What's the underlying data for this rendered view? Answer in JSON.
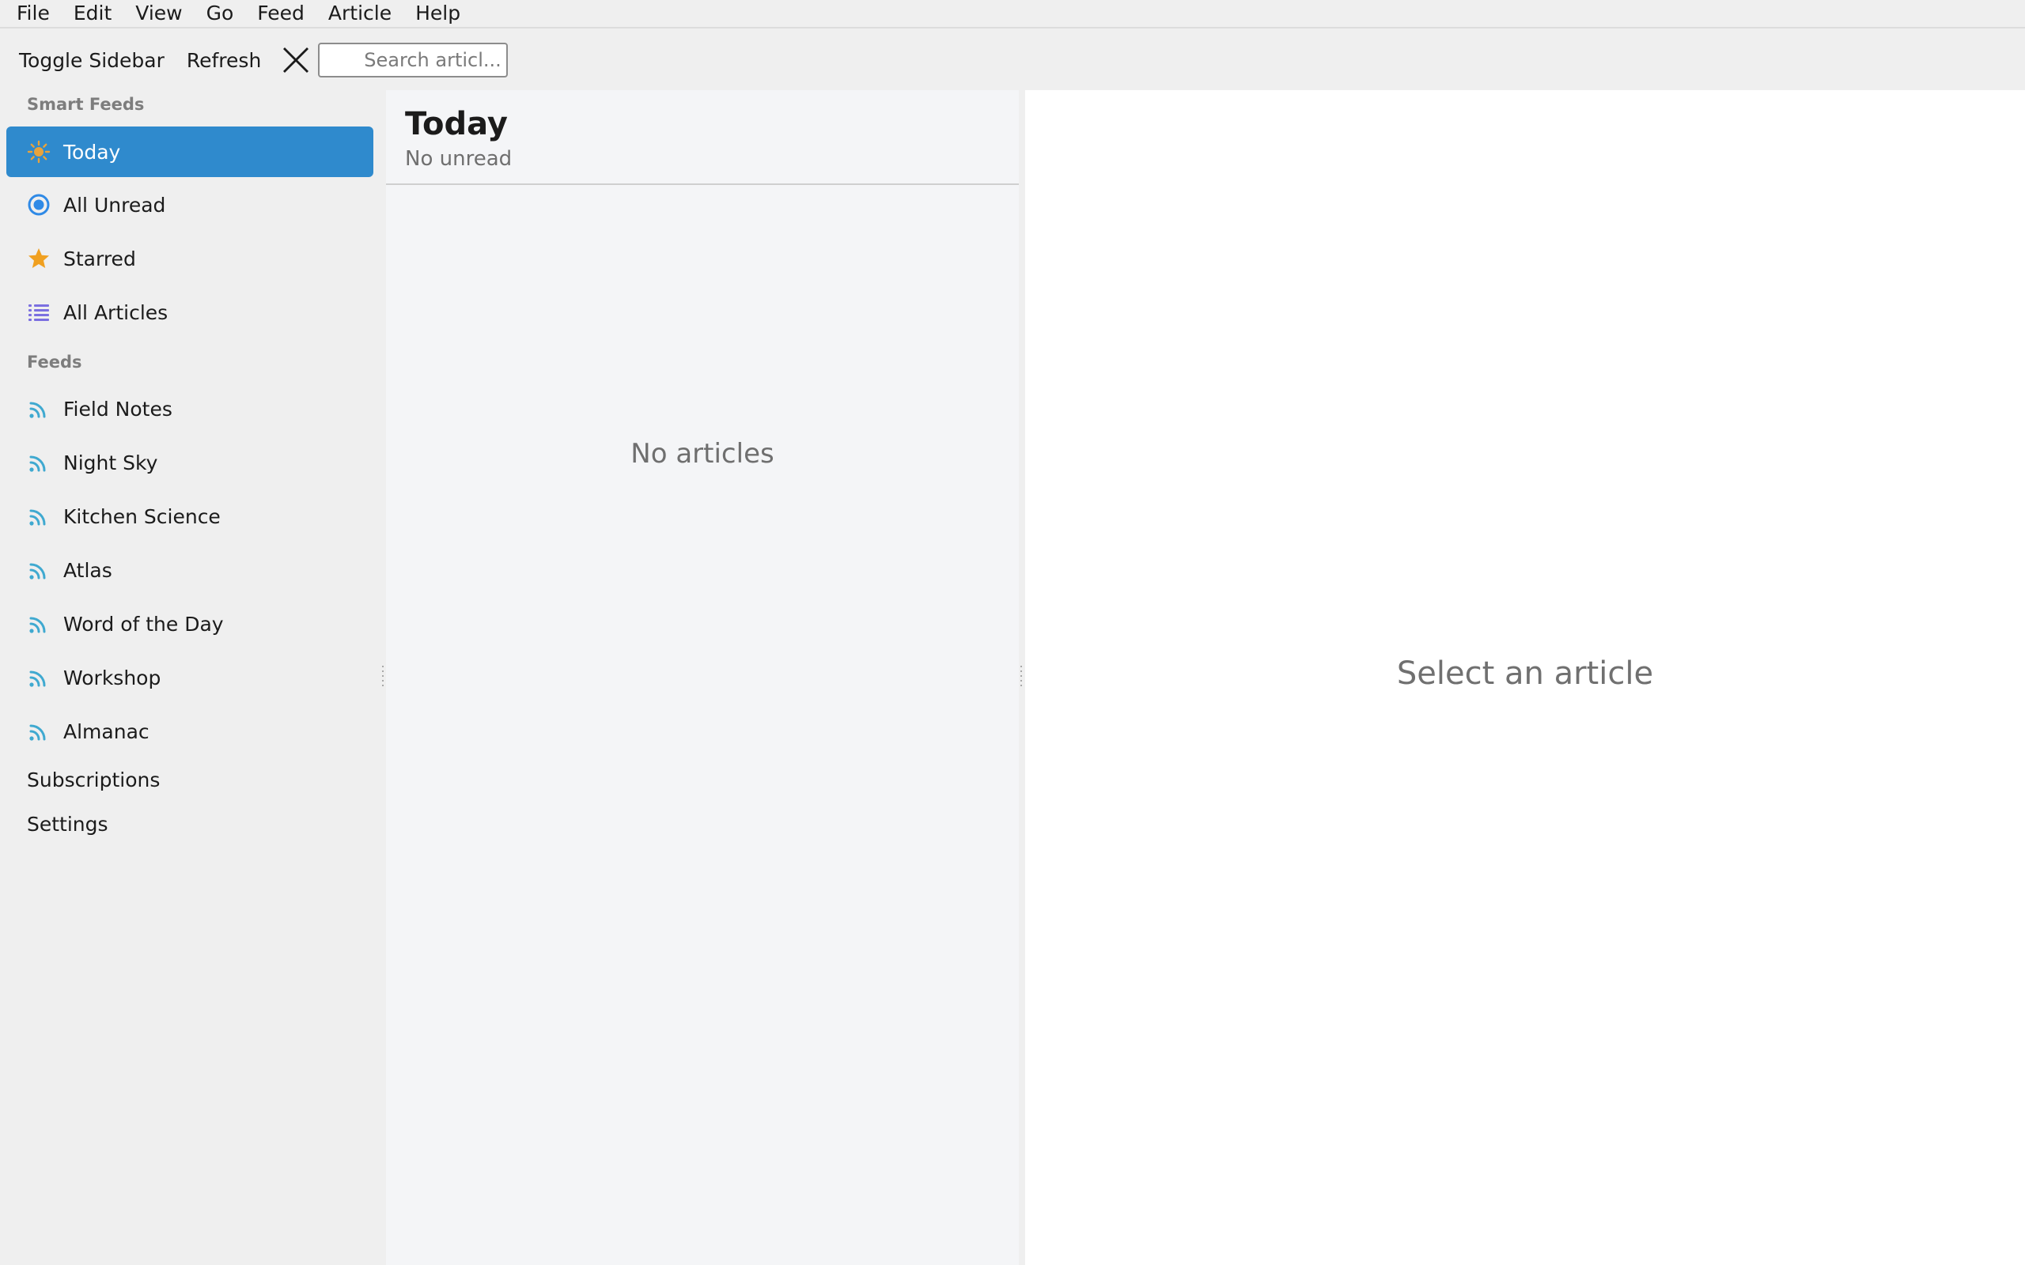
{
  "menubar": {
    "items": [
      "File",
      "Edit",
      "View",
      "Go",
      "Feed",
      "Article",
      "Help"
    ]
  },
  "toolbar": {
    "toggle_sidebar_label": "Toggle Sidebar",
    "refresh_label": "Refresh",
    "search_placeholder": "Search articl..."
  },
  "sidebar": {
    "smart_feeds_header": "Smart Feeds",
    "smart_feeds": [
      {
        "label": "Today",
        "icon": "sun-icon",
        "color": "#e8a33c"
      },
      {
        "label": "All Unread",
        "icon": "unread-circle-icon",
        "color": "#2f8ae6"
      },
      {
        "label": "Starred",
        "icon": "star-icon",
        "color": "#f0a020"
      },
      {
        "label": "All Articles",
        "icon": "list-icon",
        "color": "#7b6fe0"
      }
    ],
    "feeds_header": "Feeds",
    "feeds": [
      {
        "label": "Field Notes",
        "icon": "rss-icon"
      },
      {
        "label": "Night Sky",
        "icon": "rss-icon"
      },
      {
        "label": "Kitchen Science",
        "icon": "rss-icon"
      },
      {
        "label": "Atlas",
        "icon": "rss-icon"
      },
      {
        "label": "Word of the Day",
        "icon": "rss-icon"
      },
      {
        "label": "Workshop",
        "icon": "rss-icon"
      },
      {
        "label": "Almanac",
        "icon": "rss-icon"
      }
    ],
    "subscriptions_label": "Subscriptions",
    "settings_label": "Settings",
    "accent_color": "#2f8acd",
    "rss_color": "#3fa9d0"
  },
  "article_list": {
    "title": "Today",
    "subtitle": "No unread",
    "empty_message": "No articles"
  },
  "reader": {
    "placeholder": "Select an article"
  }
}
